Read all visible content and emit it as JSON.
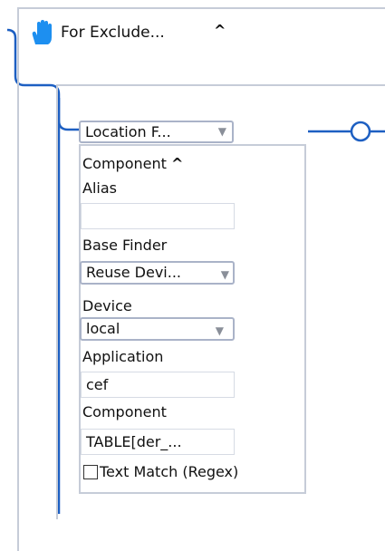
{
  "node": {
    "title": "For Exclude...",
    "collapse_icon": "caret-up",
    "hand_icon": "hand-icon",
    "accent": "#1d5fc2"
  },
  "location_finder": {
    "selected": "Location F..."
  },
  "component_panel": {
    "header": "Component",
    "alias_label": "Alias",
    "alias_value": "",
    "base_finder_label": "Base Finder",
    "base_finder_selected": "Reuse Devi...",
    "device_label": "Device",
    "device_selected": "local",
    "application_label": "Application",
    "application_value": "cef",
    "component_label": "Component",
    "component_value": "TABLE[der_...",
    "text_match_label": "Text Match (Regex)",
    "text_match_checked": false
  }
}
